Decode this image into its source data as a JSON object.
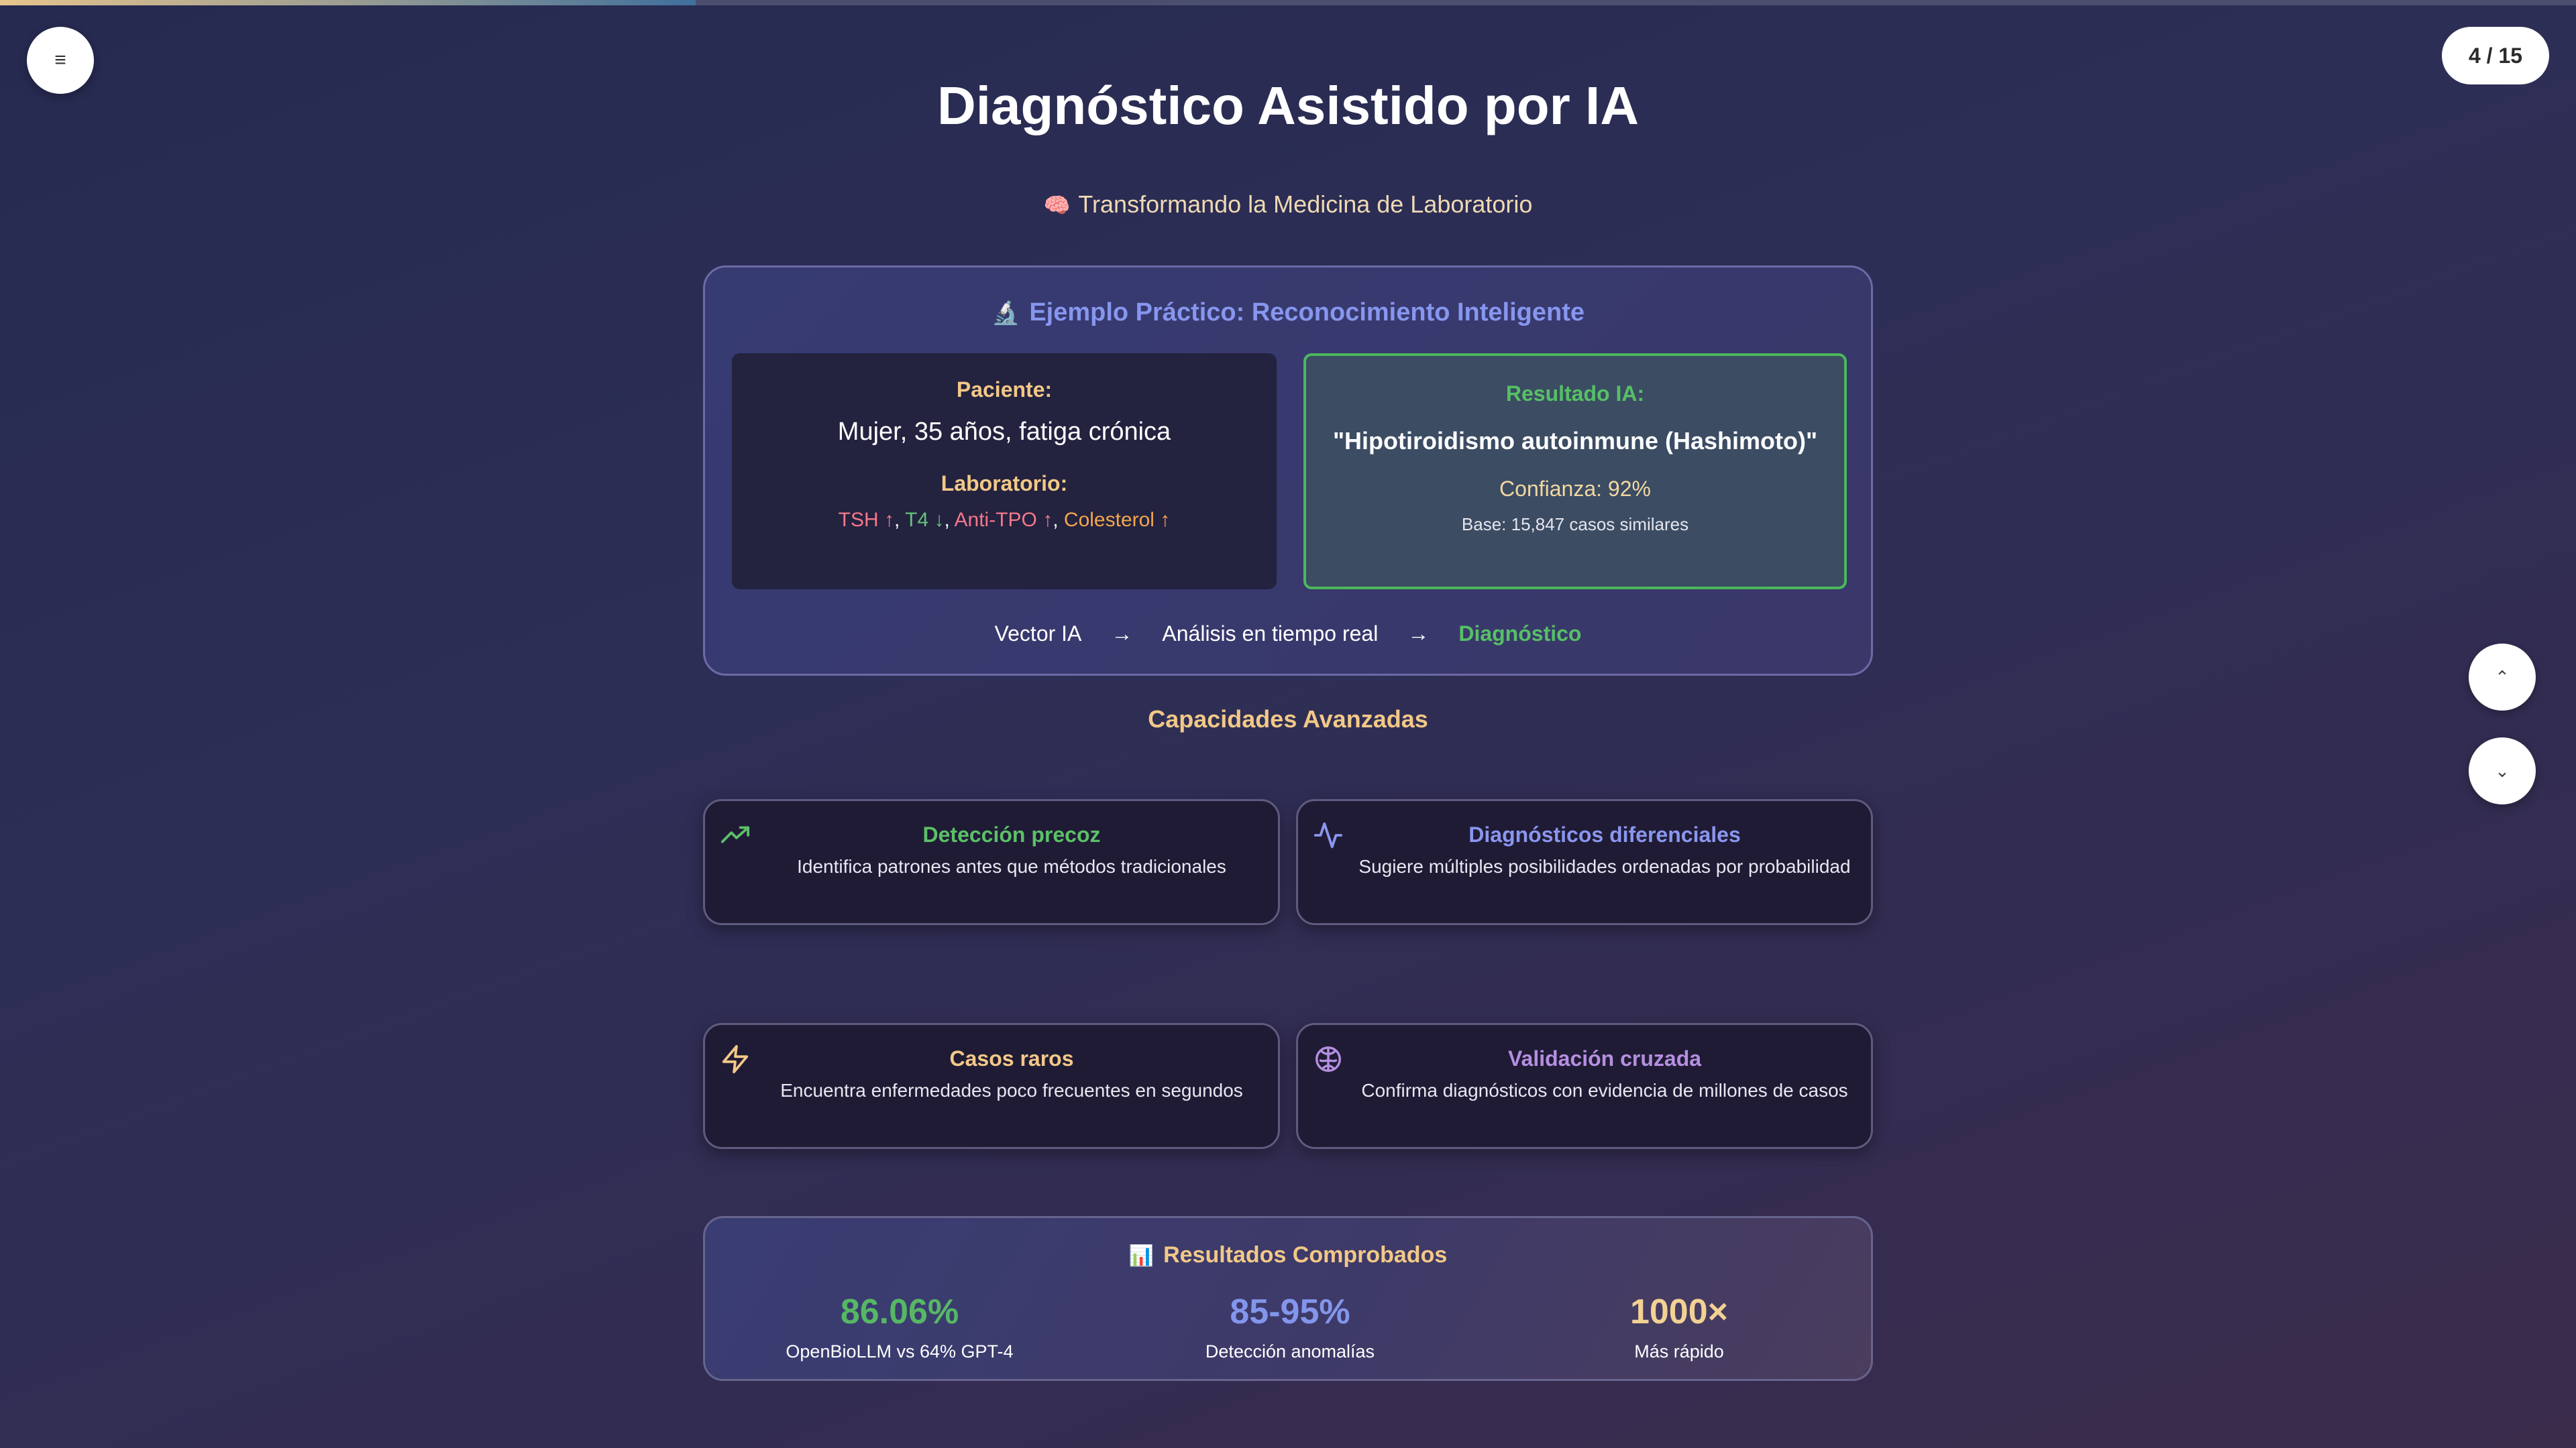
{
  "progress": {
    "percent": 27
  },
  "menu_icon": "≡",
  "counter": "4 / 15",
  "nav": {
    "up_icon": "⌃",
    "down_icon": "⌄"
  },
  "title": "Diagnóstico Asistido por IA",
  "subtitle": {
    "emoji": "🧠",
    "text": "Transformando la Medicina de Laboratorio"
  },
  "example": {
    "emoji": "🔬",
    "title": "Ejemplo Práctico: Reconocimiento Inteligente",
    "patient_label": "Paciente:",
    "patient_desc": "Mujer, 35 años, fatiga crónica",
    "lab_label": "Laboratorio:",
    "labs": [
      {
        "text": "TSH ↑",
        "color": "#f4788a"
      },
      {
        "text": "T4 ↓",
        "color": "#66c37a"
      },
      {
        "text": "Anti-TPO ↑",
        "color": "#f4788a"
      },
      {
        "text": "Colesterol ↑",
        "color": "#f3a64d"
      }
    ],
    "separator": ", ",
    "result_label": "Resultado IA:",
    "diagnosis": "\"Hipotiroidismo autoinmune (Hashimoto)\"",
    "confidence": "Confianza: 92%",
    "base": "Base: 15,847 casos similares",
    "flow": [
      "Vector IA",
      "→",
      "Análisis en tiempo real",
      "→",
      "Diagnóstico"
    ]
  },
  "capabilities_title": "Capacidades Avanzadas",
  "cards": [
    {
      "icon": "trending-up-icon",
      "title": "Detección precoz",
      "desc": "Identifica patrones antes que métodos tradicionales",
      "color": "#5cc067"
    },
    {
      "icon": "activity-icon",
      "title": "Diagnósticos diferenciales",
      "desc": "Sugiere múltiples posibilidades ordenadas por probabilidad",
      "color": "#8a96ee"
    },
    {
      "icon": "lightning-icon",
      "title": "Casos raros",
      "desc": "Encuentra enfermedades poco frecuentes en segundos",
      "color": "#f3c887"
    },
    {
      "icon": "brain-icon",
      "title": "Validación cruzada",
      "desc": "Confirma diagnósticos con evidencia de millones de casos",
      "color": "#b58fe0"
    }
  ],
  "results": {
    "emoji": "📊",
    "title": "Resultados Comprobados",
    "stats": [
      {
        "value": "86.06%",
        "label": "OpenBioLLM vs 64% GPT-4"
      },
      {
        "value": "85-95%",
        "label": "Detección anomalías"
      },
      {
        "value": "1000×",
        "label": "Más rápido"
      }
    ]
  }
}
